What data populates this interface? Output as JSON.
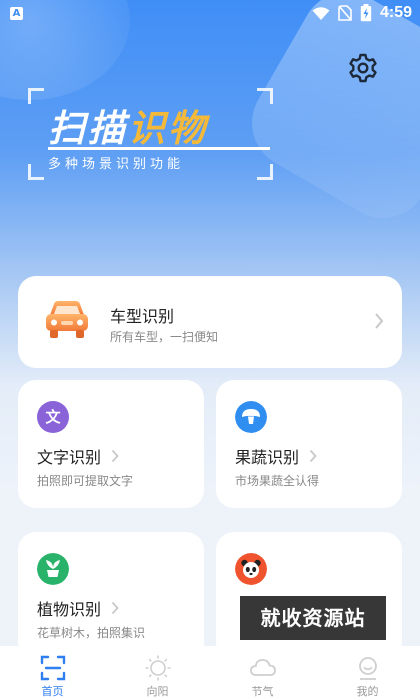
{
  "status_bar": {
    "app_icon_letter": "A",
    "battery": "⚡",
    "time": "4:59",
    "icons": [
      "wifi-icon",
      "no-sim-icon",
      "battery-icon"
    ]
  },
  "header": {
    "settings_icon": "gear-icon"
  },
  "banner": {
    "title_main": "扫描",
    "title_highlight": "识物",
    "subtitle": "多种场景识别功能",
    "highlight_color": "#f5b93a"
  },
  "cards": {
    "car": {
      "title": "车型识别",
      "desc": "所有车型，一扫便知",
      "icon": "car-icon"
    },
    "text": {
      "title": "文字识别",
      "desc": "拍照即可提取文字",
      "icon_letter": "文",
      "icon_color": "#8a63d8"
    },
    "fruit": {
      "title": "果蔬识别",
      "desc": "市场果蔬全认得",
      "icon": "mushroom-icon",
      "icon_color": "#2f8ef0"
    },
    "plant": {
      "title": "植物识别",
      "desc": "花草树木，拍照集识",
      "icon": "plant-icon",
      "icon_color": "#29b36a"
    },
    "animal": {
      "icon": "panda-icon",
      "icon_color": "#f0542e"
    }
  },
  "watermark": "就收资源站",
  "bottom_nav": {
    "items": [
      {
        "label": "首页",
        "icon": "scan-icon",
        "active": true
      },
      {
        "label": "向阳",
        "icon": "sun-icon",
        "active": false
      },
      {
        "label": "节气",
        "icon": "cloud-icon",
        "active": false
      },
      {
        "label": "我的",
        "icon": "profile-icon",
        "active": false
      }
    ],
    "active_color": "#2f7ff0"
  }
}
